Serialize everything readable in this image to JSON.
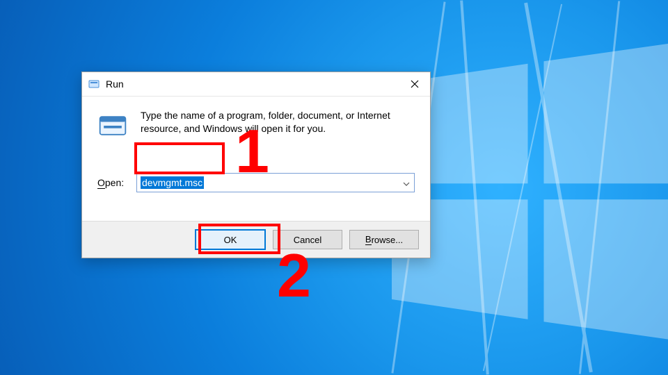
{
  "dialog": {
    "title": "Run",
    "description": "Type the name of a program, folder, document, or Internet resource, and Windows will open it for you.",
    "open_label_letter": "O",
    "open_label_rest": "pen:",
    "input_value": "devmgmt.msc",
    "buttons": {
      "ok": "OK",
      "cancel": "Cancel",
      "browse": "Browse..."
    }
  },
  "annotations": {
    "num1": "1",
    "num2": "2"
  }
}
